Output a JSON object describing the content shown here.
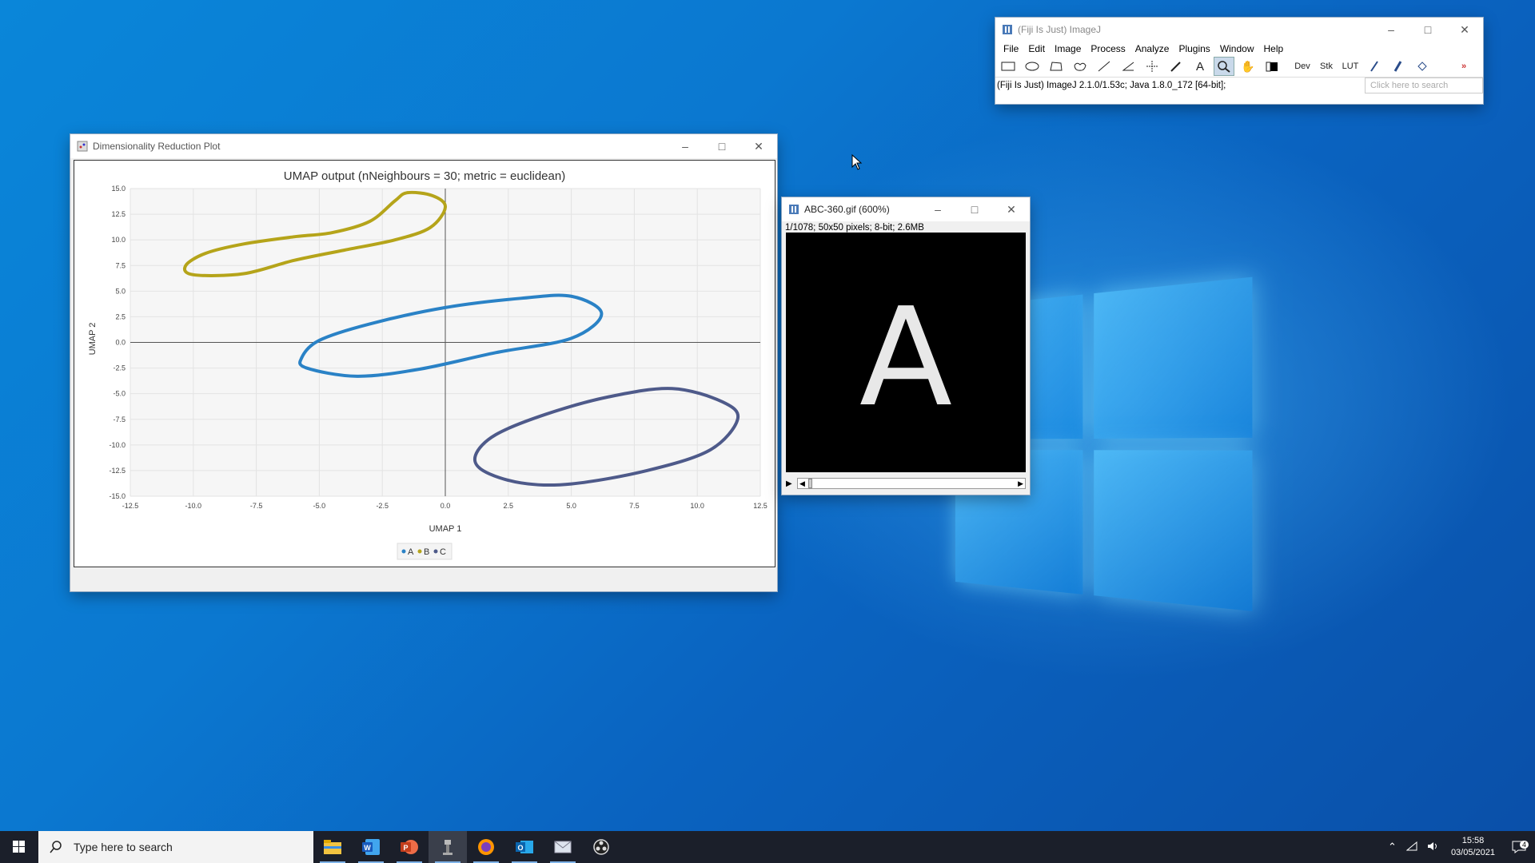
{
  "fiji": {
    "title": "(Fiji Is Just) ImageJ",
    "menu": [
      "File",
      "Edit",
      "Image",
      "Process",
      "Analyze",
      "Plugins",
      "Window",
      "Help"
    ],
    "status": "(Fiji Is Just) ImageJ 2.1.0/1.53c; Java 1.8.0_172 [64-bit];",
    "search_placeholder": "Click here to search",
    "tools": [
      "rectangle-icon",
      "oval-icon",
      "polygon-icon",
      "freehand-icon",
      "line-icon",
      "angle-icon",
      "point-icon",
      "wand-icon",
      "text-icon",
      "magnifier-icon",
      "hand-icon",
      "color-picker-icon",
      "Dev",
      "Stk",
      "LUT",
      "pencil-icon",
      "brush-icon",
      "flood-fill-icon",
      "more-tools-icon"
    ]
  },
  "plot_window": {
    "title": "Dimensionality Reduction Plot"
  },
  "image_window": {
    "title": "ABC-360.gif (600%)",
    "info": "1/1078; 50x50 pixels; 8-bit; 2.6MB",
    "letter": "A"
  },
  "chart_data": {
    "type": "scatter",
    "title": "UMAP output (nNeighbours = 30; metric = euclidean)",
    "xlabel": "UMAP 1",
    "ylabel": "UMAP 2",
    "xlim": [
      -12.5,
      12.5
    ],
    "ylim": [
      -15.0,
      15.0
    ],
    "xticks": [
      "-12.5",
      "-10.0",
      "-7.5",
      "-5.0",
      "-2.5",
      "0.0",
      "2.5",
      "5.0",
      "7.5",
      "10.0",
      "12.5"
    ],
    "yticks": [
      "15.0",
      "12.5",
      "10.0",
      "7.5",
      "5.0",
      "2.5",
      "0.0",
      "-2.5",
      "-5.0",
      "-7.5",
      "-10.0",
      "-12.5",
      "-15.0"
    ],
    "grid": true,
    "legend": "bottom-center",
    "series": [
      {
        "name": "A",
        "color": "#b5a41a",
        "points": [
          [
            -10.3,
            7.5
          ],
          [
            -9.5,
            8.7
          ],
          [
            -8,
            9.6
          ],
          [
            -6,
            10.3
          ],
          [
            -4.5,
            10.7
          ],
          [
            -3,
            11.8
          ],
          [
            -2,
            13.8
          ],
          [
            -1.5,
            14.6
          ],
          [
            -0.5,
            14.3
          ],
          [
            0,
            13.2
          ],
          [
            -0.6,
            11.2
          ],
          [
            -2,
            10
          ],
          [
            -4,
            9
          ],
          [
            -6,
            8
          ],
          [
            -8,
            6.7
          ],
          [
            -10,
            6.6
          ],
          [
            -10.3,
            7.5
          ]
        ]
      },
      {
        "name": "B",
        "color": "#2a82c6",
        "points": [
          [
            -5.7,
            -1.5
          ],
          [
            -5,
            0.2
          ],
          [
            -3,
            1.8
          ],
          [
            0,
            3.4
          ],
          [
            3,
            4.3
          ],
          [
            5,
            4.5
          ],
          [
            6.2,
            2.8
          ],
          [
            5,
            0.4
          ],
          [
            2,
            -1
          ],
          [
            -1,
            -2.6
          ],
          [
            -3.5,
            -3.3
          ],
          [
            -5.5,
            -2.5
          ],
          [
            -5.7,
            -1.5
          ]
        ]
      },
      {
        "name": "C",
        "color": "#4e5a8a",
        "points": [
          [
            1.2,
            -11
          ],
          [
            2,
            -9
          ],
          [
            4,
            -7
          ],
          [
            6.5,
            -5.3
          ],
          [
            9,
            -4.5
          ],
          [
            11,
            -5.8
          ],
          [
            11.6,
            -7.5
          ],
          [
            10.5,
            -10.5
          ],
          [
            8,
            -12.5
          ],
          [
            5,
            -13.8
          ],
          [
            3,
            -13.7
          ],
          [
            1.5,
            -12.5
          ],
          [
            1.2,
            -11
          ]
        ]
      }
    ]
  },
  "taskbar": {
    "search_placeholder": "Type here to search",
    "apps": [
      "file-explorer-icon",
      "word-icon",
      "powerpoint-icon",
      "fiji-icon",
      "firefox-icon",
      "outlook-icon",
      "mail-icon",
      "obs-icon"
    ],
    "time": "15:58",
    "date": "03/05/2021",
    "notifications": "4"
  }
}
